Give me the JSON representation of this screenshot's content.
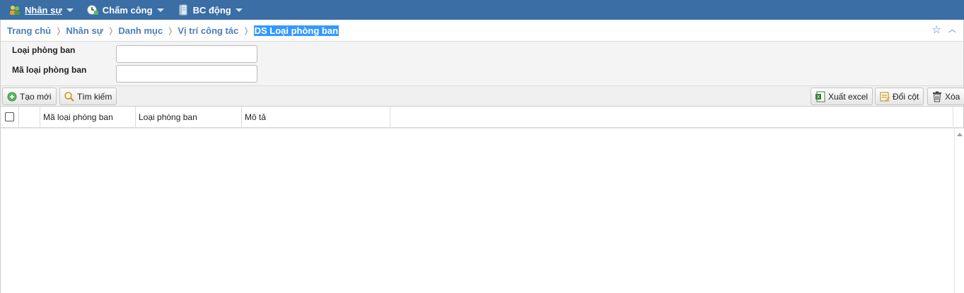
{
  "nav": {
    "items": [
      {
        "label": "Nhân sự",
        "icon": "users-icon"
      },
      {
        "label": "Chấm công",
        "icon": "clock-icon"
      },
      {
        "label": "BC động",
        "icon": "notebook-icon"
      }
    ]
  },
  "breadcrumb": {
    "items": [
      "Trang chủ",
      "Nhân sự",
      "Danh mục",
      "Vị trí công tác"
    ],
    "current": "DS Loại phòng ban",
    "separator": "❭"
  },
  "filter": {
    "fields": [
      {
        "label": "Loại phòng ban",
        "value": "",
        "placeholder": ""
      },
      {
        "label": "Mã loại phòng ban",
        "value": "",
        "placeholder": ""
      }
    ]
  },
  "toolbar": {
    "create_label": "Tạo mới",
    "search_label": "Tìm kiếm",
    "export_label": "Xuất excel",
    "columns_label": "Đổi cột",
    "delete_label": "Xóa"
  },
  "grid": {
    "columns": [
      "Mã loại phòng ban",
      "Loại phòng ban",
      "Mô tả"
    ],
    "rows": []
  },
  "colors": {
    "nav_bg": "#3a6ea5",
    "link": "#4a7ebb",
    "highlight": "#3399ff"
  }
}
